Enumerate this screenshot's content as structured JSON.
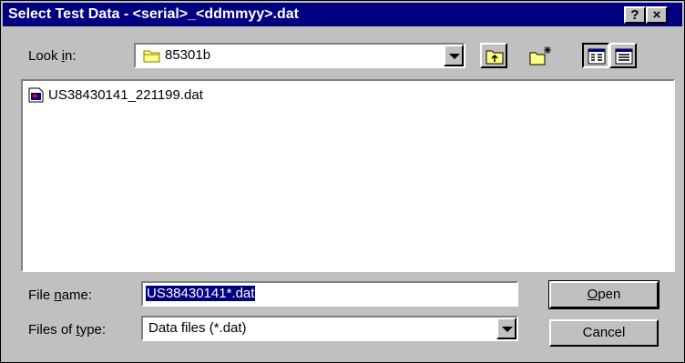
{
  "window": {
    "title": "Select Test Data - <serial>_<ddmmyy>.dat",
    "help_glyph": "?",
    "close_glyph": "×"
  },
  "look_in": {
    "label_before": "Look ",
    "label_underlined": "i",
    "label_after": "n:",
    "value": "85301b"
  },
  "toolbar": {
    "up_icon": "up-folder-icon",
    "new_folder_icon": "new-folder-icon",
    "list_view_icon": "list-view-icon",
    "details_view_icon": "details-view-icon"
  },
  "files": [
    {
      "name": "US38430141_221199.dat",
      "icon": "data-file-icon"
    }
  ],
  "file_name": {
    "label_before": "File ",
    "label_underlined": "n",
    "label_after": "ame:",
    "value": "US38430141*.dat"
  },
  "file_type": {
    "label_before": "Files of ",
    "label_underlined": "t",
    "label_after": "ype:",
    "value": "Data files (*.dat)"
  },
  "buttons": {
    "open_underlined": "O",
    "open_rest": "pen",
    "cancel": "Cancel"
  }
}
